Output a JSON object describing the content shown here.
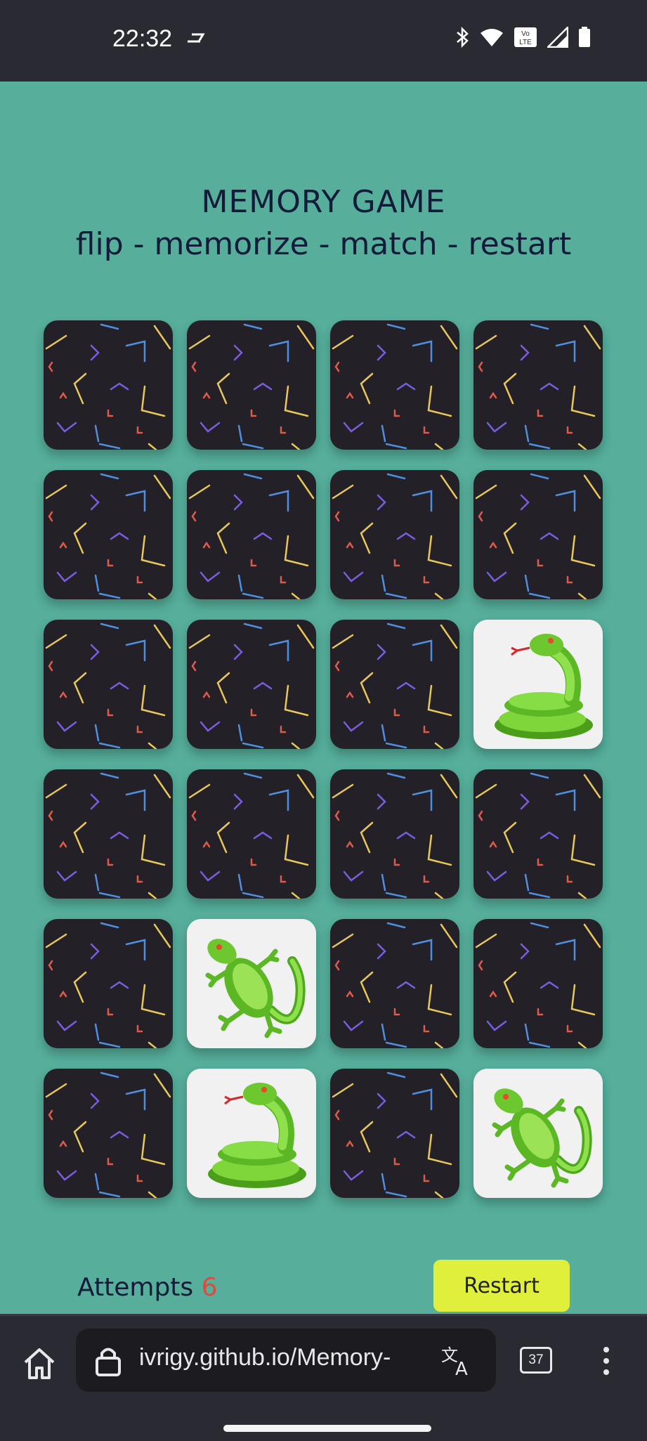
{
  "status_bar": {
    "time": "22:32",
    "icons": [
      "bluetooth-icon",
      "wifi-icon",
      "volte-icon",
      "signal-icon",
      "battery-icon"
    ],
    "volte_label": "Vo\nLTE"
  },
  "page": {
    "title": "MEMORY GAME",
    "subtitle": "flip - memorize - match - restart"
  },
  "board": {
    "rows": 6,
    "cols": 4,
    "cards": [
      "back",
      "back",
      "back",
      "back",
      "back",
      "back",
      "back",
      "back",
      "back",
      "back",
      "back",
      "snake",
      "back",
      "back",
      "back",
      "back",
      "back",
      "lizard",
      "back",
      "back",
      "back",
      "snake",
      "back",
      "lizard"
    ]
  },
  "footer": {
    "attempts_label": "Attempts",
    "attempts_count": "6",
    "restart_label": "Restart"
  },
  "browser": {
    "url": "ivrigy.github.io/Memory-",
    "tab_count": "37"
  },
  "colors": {
    "background": "#56ae9b",
    "card_back": "#232127",
    "card_face": "#f1f1f1",
    "title_text": "#131b3a",
    "attempts_count": "#e04a3a",
    "restart_button": "#dfef3c",
    "system_bars": "#2a2a33"
  }
}
